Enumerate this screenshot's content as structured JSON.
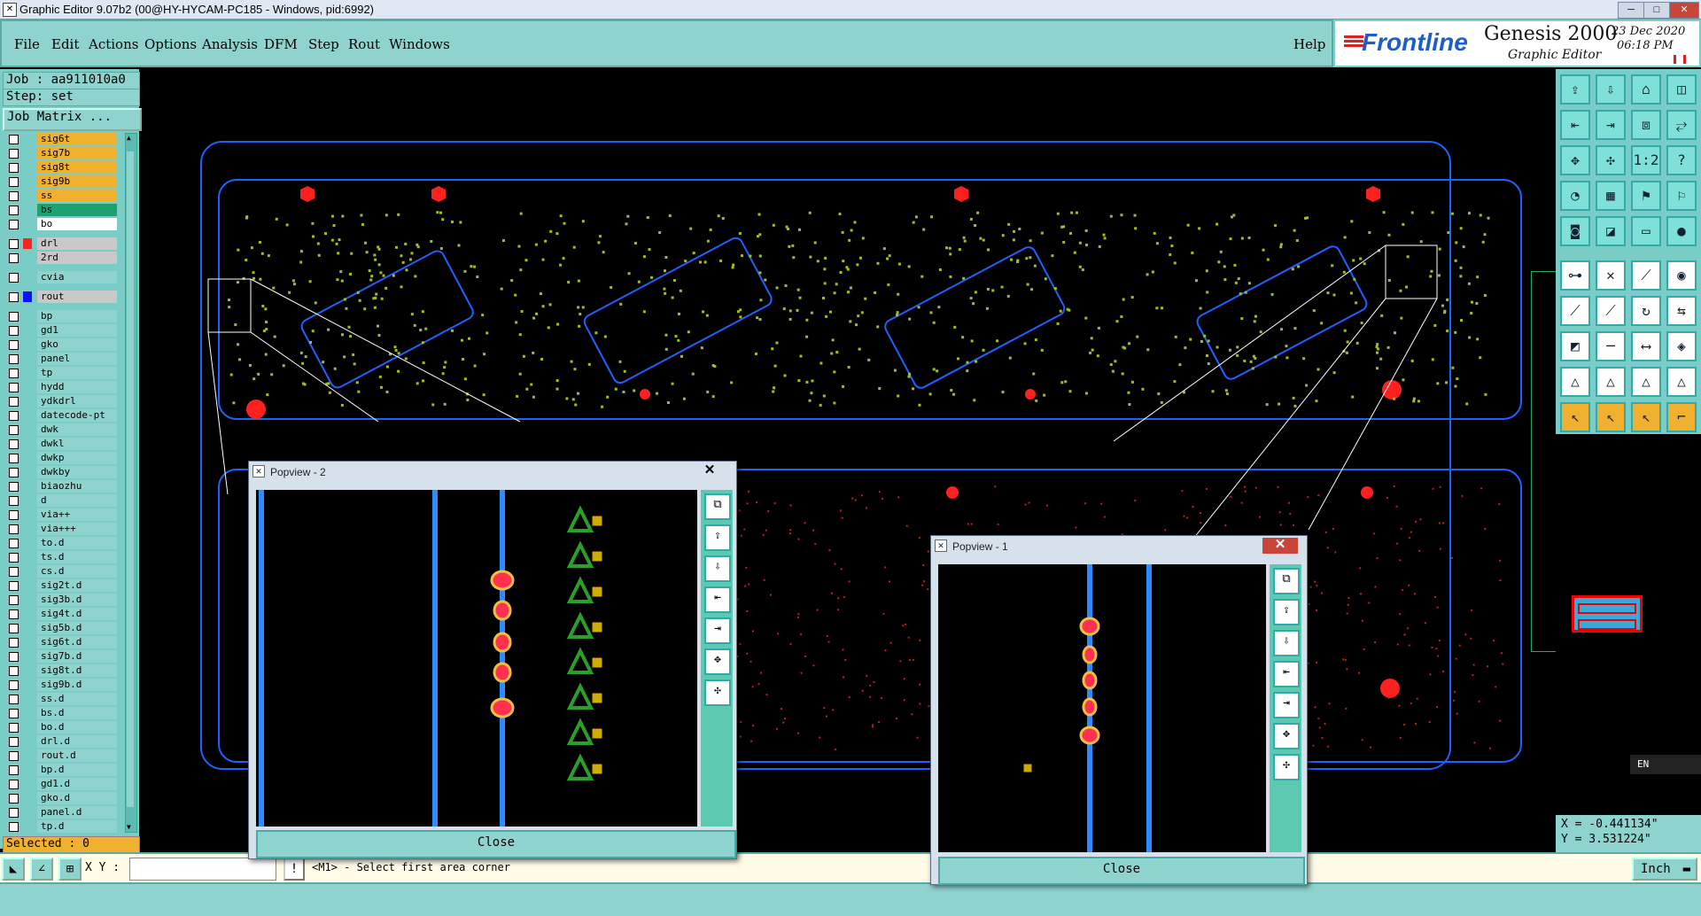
{
  "window": {
    "title": "Graphic Editor 9.07b2 (00@HY-HYCAM-PC185 - Windows, pid:6992)",
    "icon_glyph": "✕",
    "controls": [
      "─",
      "□",
      "✕"
    ]
  },
  "menu": {
    "items": [
      "File",
      "Edit",
      "Actions",
      "Options",
      "Analysis",
      "DFM",
      "Step",
      "Rout",
      "Windows"
    ],
    "help": "Help"
  },
  "brand": {
    "logo": "Frontline",
    "product": "Genesis 2000",
    "subtitle": "Graphic Editor",
    "date": "23 Dec 2020",
    "time": "06:18 PM"
  },
  "job": {
    "job_label": "Job : aa911010a0",
    "step_label": "Step: set",
    "matrix_button": "Job Matrix ...",
    "selected": "Selected : 0"
  },
  "layers": [
    {
      "name": "sig6t",
      "color": "#f0b030"
    },
    {
      "name": "sig7b",
      "color": "#f0b030"
    },
    {
      "name": "sig8t",
      "color": "#f0b030"
    },
    {
      "name": "sig9b",
      "color": "#f0b030"
    },
    {
      "name": "ss",
      "color": "#f0b030"
    },
    {
      "name": "bs",
      "color": "#1ea070"
    },
    {
      "name": "bo",
      "color": "#ffffff"
    },
    {
      "name": "drl",
      "color": "#c8c8c8",
      "swatch": "#ff2020"
    },
    {
      "name": "2rd",
      "color": "#c8c8c8"
    },
    {
      "name": "cvia",
      "color": "#8fd3cf"
    },
    {
      "name": "rout",
      "color": "#c8c8c8",
      "swatch": "#1010ff"
    },
    {
      "name": "bp"
    },
    {
      "name": "gd1"
    },
    {
      "name": "gko"
    },
    {
      "name": "panel"
    },
    {
      "name": "tp"
    },
    {
      "name": "hydd"
    },
    {
      "name": "ydkdrl"
    },
    {
      "name": "datecode-pt"
    },
    {
      "name": "dwk"
    },
    {
      "name": "dwkl"
    },
    {
      "name": "dwkp"
    },
    {
      "name": "dwkby"
    },
    {
      "name": "biaozhu"
    },
    {
      "name": "d"
    },
    {
      "name": "via++"
    },
    {
      "name": "via+++"
    },
    {
      "name": "to.d"
    },
    {
      "name": "ts.d"
    },
    {
      "name": "cs.d"
    },
    {
      "name": "sig2t.d"
    },
    {
      "name": "sig3b.d"
    },
    {
      "name": "sig4t.d"
    },
    {
      "name": "sig5b.d"
    },
    {
      "name": "sig6t.d"
    },
    {
      "name": "sig7b.d"
    },
    {
      "name": "sig8t.d"
    },
    {
      "name": "sig9b.d"
    },
    {
      "name": "ss.d"
    },
    {
      "name": "bs.d"
    },
    {
      "name": "bo.d"
    },
    {
      "name": "drl.d"
    },
    {
      "name": "rout.d"
    },
    {
      "name": "bp.d"
    },
    {
      "name": "gd1.d"
    },
    {
      "name": "gko.d"
    },
    {
      "name": "panel.d"
    },
    {
      "name": "tp.d"
    }
  ],
  "popviews": [
    {
      "title": "Popview - 2",
      "close": "Close"
    },
    {
      "title": "Popview - 1",
      "close": "Close"
    }
  ],
  "coords": {
    "x": "X = -0.441134\"",
    "y": "Y = 3.531224\""
  },
  "bottom": {
    "xy_label": "X Y :",
    "xy_value": "",
    "prompt": "<M1> - Select first area corner",
    "units": "Inch",
    "lang": "EN"
  },
  "colors": {
    "accent": "#8fd3cf",
    "board_outline": "#2060ff",
    "pads": "#a0c020",
    "drill": "#ff2020"
  }
}
